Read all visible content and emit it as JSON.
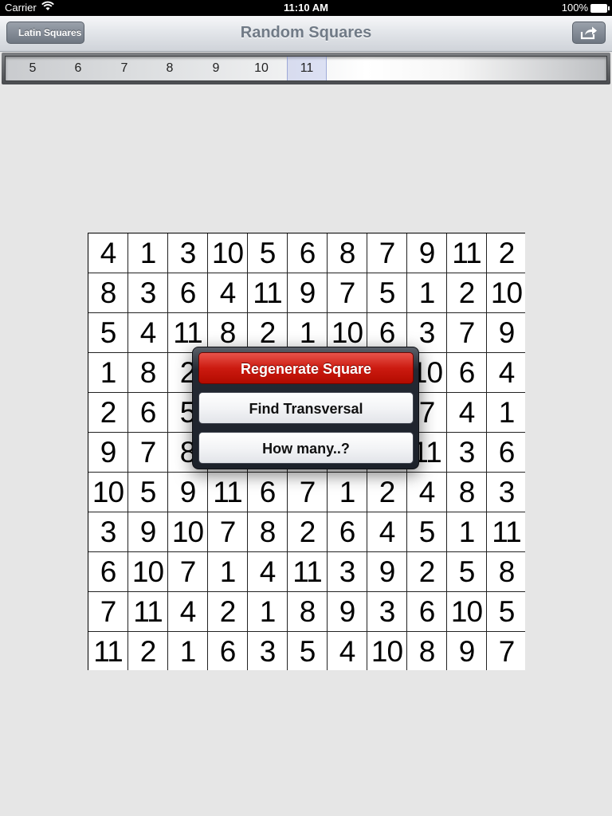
{
  "status_bar": {
    "carrier": "Carrier",
    "time": "11:10 AM",
    "battery": "100%"
  },
  "navbar": {
    "title": "Random Squares",
    "back_label": "Latin Squares",
    "share_icon": "share-icon"
  },
  "size_picker": {
    "options": [
      "5",
      "6",
      "7",
      "8",
      "9",
      "10",
      "11"
    ],
    "selected": "11"
  },
  "grid": {
    "rows": [
      [
        "4",
        "1",
        "3",
        "10",
        "5",
        "6",
        "8",
        "7",
        "9",
        "11",
        "2"
      ],
      [
        "8",
        "3",
        "6",
        "4",
        "11",
        "9",
        "7",
        "5",
        "1",
        "2",
        "10"
      ],
      [
        "5",
        "4",
        "11",
        "8",
        "2",
        "1",
        "10",
        "6",
        "3",
        "7",
        "9"
      ],
      [
        "1",
        "8",
        "2",
        "",
        "",
        "",
        "",
        "",
        "10",
        "6",
        "4"
      ],
      [
        "2",
        "6",
        "5",
        "",
        "",
        "",
        "",
        "",
        "7",
        "4",
        "1"
      ],
      [
        "9",
        "7",
        "8",
        "",
        "",
        "",
        "",
        "",
        "11",
        "3",
        "6"
      ],
      [
        "10",
        "5",
        "9",
        "11",
        "6",
        "7",
        "1",
        "2",
        "4",
        "8",
        "3"
      ],
      [
        "3",
        "9",
        "10",
        "7",
        "8",
        "2",
        "6",
        "4",
        "5",
        "1",
        "11"
      ],
      [
        "6",
        "10",
        "7",
        "1",
        "4",
        "11",
        "3",
        "9",
        "2",
        "5",
        "8"
      ],
      [
        "7",
        "11",
        "4",
        "2",
        "1",
        "8",
        "9",
        "3",
        "6",
        "10",
        "5"
      ],
      [
        "11",
        "2",
        "1",
        "6",
        "3",
        "5",
        "4",
        "10",
        "8",
        "9",
        "7"
      ]
    ]
  },
  "action_sheet": {
    "regenerate": "Regenerate Square",
    "find_transversal": "Find Transversal",
    "how_many": "How many..?"
  },
  "colors": {
    "background": "#e6e6e6",
    "destructive": "#cc1a10",
    "nav_title": "#707a86"
  }
}
